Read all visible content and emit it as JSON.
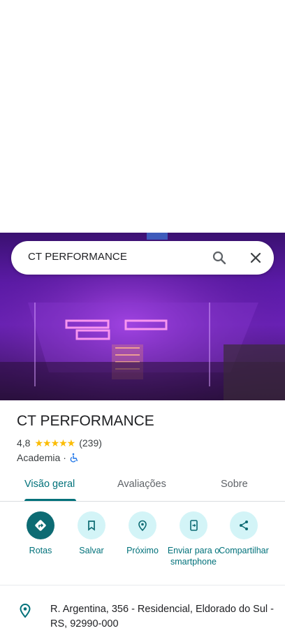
{
  "search": {
    "query": "CT PERFORMANCE"
  },
  "place": {
    "name": "CT PERFORMANCE",
    "rating": "4,8",
    "stars": "★★★★★",
    "review_count": "(239)",
    "category": "Academia",
    "separator": "·"
  },
  "tabs": [
    {
      "label": "Visão geral",
      "active": true
    },
    {
      "label": "Avaliações",
      "active": false
    },
    {
      "label": "Sobre",
      "active": false
    }
  ],
  "actions": [
    {
      "label": "Rotas",
      "icon": "directions-icon"
    },
    {
      "label": "Salvar",
      "icon": "bookmark-icon"
    },
    {
      "label": "Próximo",
      "icon": "nearby-icon"
    },
    {
      "label": "Enviar para o smartphone",
      "icon": "send-to-phone-icon"
    },
    {
      "label": "Compartilhar",
      "icon": "share-icon"
    }
  ],
  "address": {
    "text": "R. Argentina, 356 - Residencial, Eldorado do Sul - RS, 92990-000"
  },
  "colors": {
    "accent": "#00717a",
    "accent_dark": "#0d6b73",
    "action_bg": "#d3f4f7",
    "star": "#fbbc04"
  }
}
